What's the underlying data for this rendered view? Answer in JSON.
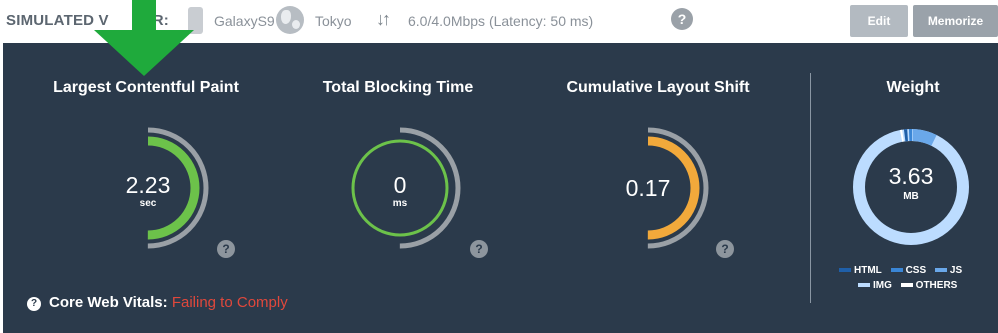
{
  "topbar": {
    "sim_label": "SIMULATED V",
    "sim_label_tail": "R:",
    "device": "GalaxyS9",
    "location": "Tokyo",
    "speed_icon": "up-down-arrows",
    "speed": "6.0/4.0Mbps (Latency: 50 ms)",
    "help": "?",
    "edit_label": "Edit",
    "memorize_label": "Memorize"
  },
  "metrics": [
    {
      "title": "Largest Contentful Paint",
      "value": "2.23",
      "unit": "sec",
      "help": "?",
      "status_color": "#6cc24a"
    },
    {
      "title": "Total Blocking Time",
      "value": "0",
      "unit": "ms",
      "help": "?",
      "status_color": "#6cc24a"
    },
    {
      "title": "Cumulative Layout Shift",
      "value": "0.17",
      "unit": "",
      "help": "?",
      "status_color": "#f2a93b"
    }
  ],
  "weight": {
    "title": "Weight",
    "value": "3.63",
    "unit": "MB",
    "legend": [
      {
        "label": "HTML",
        "color": "#1f5fa8"
      },
      {
        "label": "CSS",
        "color": "#3a86d6"
      },
      {
        "label": "JS",
        "color": "#6aa8ea"
      },
      {
        "label": "IMG",
        "color": "#bcdcff"
      },
      {
        "label": "OTHERS",
        "color": "#ffffff"
      }
    ]
  },
  "footer": {
    "label": "Core Web Vitals:",
    "status": "Failing to Comply",
    "status_color": "#e0483c",
    "icon": "?"
  },
  "colors": {
    "panel": "#2b3a4b",
    "gauge_track": "#9aa0a6",
    "arrow": "#1faa3c"
  }
}
